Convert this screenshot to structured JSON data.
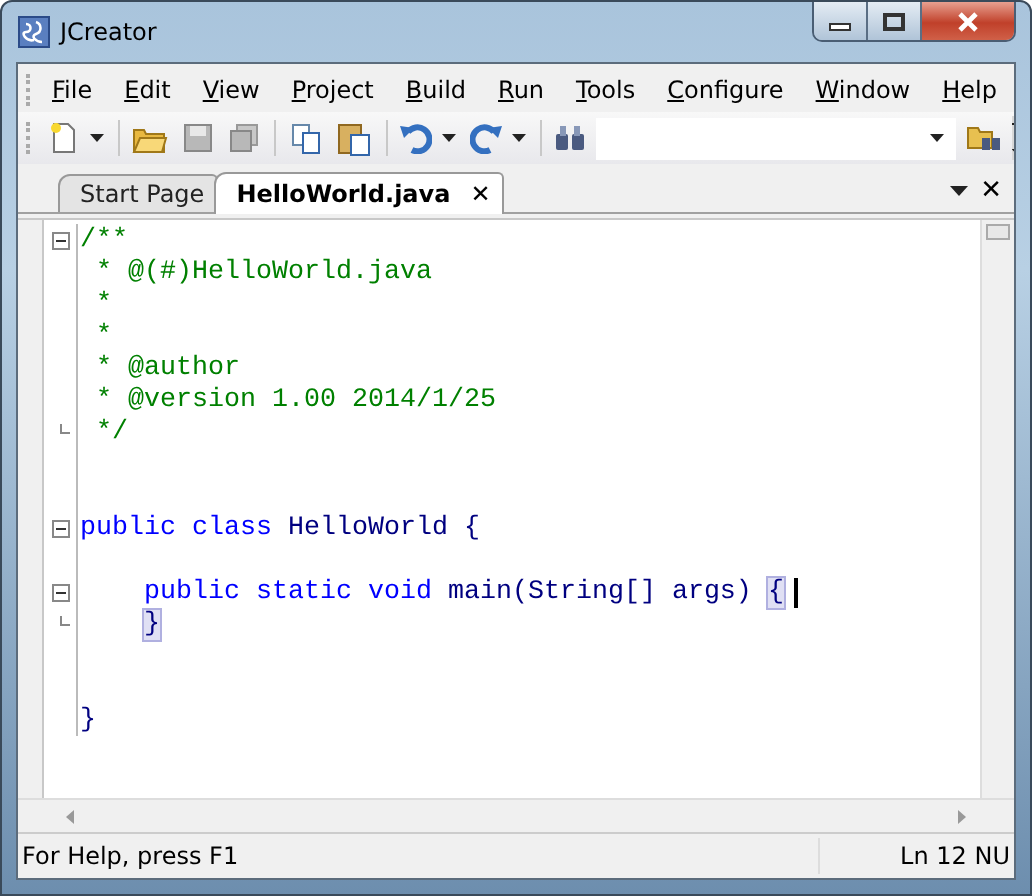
{
  "window": {
    "title": "JCreator"
  },
  "menu": [
    "File",
    "Edit",
    "View",
    "Project",
    "Build",
    "Run",
    "Tools",
    "Configure",
    "Window",
    "Help"
  ],
  "tabs": [
    {
      "label": "Start Page",
      "selected": false
    },
    {
      "label": "HelloWorld.java",
      "selected": true,
      "close": "✕"
    }
  ],
  "tab_strip_close": "✕",
  "editor": {
    "lines": [
      {
        "fold_start": true,
        "fold_end": false,
        "tokens": [
          {
            "kind": "comment",
            "text": "/**"
          }
        ]
      },
      {
        "fold_start": false,
        "fold_end": false,
        "tokens": [
          {
            "kind": "comment",
            "text": " * @(#)HelloWorld.java"
          }
        ]
      },
      {
        "fold_start": false,
        "fold_end": false,
        "tokens": [
          {
            "kind": "comment",
            "text": " *"
          }
        ]
      },
      {
        "fold_start": false,
        "fold_end": false,
        "tokens": [
          {
            "kind": "comment",
            "text": " *"
          }
        ]
      },
      {
        "fold_start": false,
        "fold_end": false,
        "tokens": [
          {
            "kind": "comment",
            "text": " * @author"
          }
        ]
      },
      {
        "fold_start": false,
        "fold_end": false,
        "tokens": [
          {
            "kind": "comment",
            "text": " * @version 1.00 2014/1/25"
          }
        ]
      },
      {
        "fold_start": false,
        "fold_end": true,
        "tokens": [
          {
            "kind": "comment",
            "text": " */"
          }
        ]
      },
      {
        "fold_start": false,
        "fold_end": false
      },
      {
        "fold_start": false,
        "fold_end": false
      },
      {
        "fold_start": true,
        "fold_end": false,
        "tokens": [
          {
            "kind": "keyword",
            "text": "public class"
          },
          {
            "kind": "plain",
            "text": " HelloWorld {"
          }
        ]
      },
      {
        "fold_start": false,
        "fold_end": false
      },
      {
        "fold_start": true,
        "fold_end": false,
        "cursor": true,
        "tokens": [
          {
            "kind": "keyword",
            "text": "    public static void"
          },
          {
            "kind": "plain",
            "text": " main(String[] args) "
          },
          {
            "kind": "brace",
            "text": "{"
          }
        ]
      },
      {
        "fold_start": false,
        "fold_end": true,
        "tokens": [
          {
            "kind": "brace",
            "text": "    }"
          }
        ]
      },
      {
        "fold_start": false,
        "fold_end": false
      },
      {
        "fold_start": false,
        "fold_end": false
      },
      {
        "fold_start": false,
        "fold_end": false,
        "tokens": [
          {
            "kind": "plain",
            "text": "}"
          }
        ]
      }
    ]
  },
  "status_bar": {
    "message": "For Help, press F1",
    "position": "Ln 12 NU"
  }
}
